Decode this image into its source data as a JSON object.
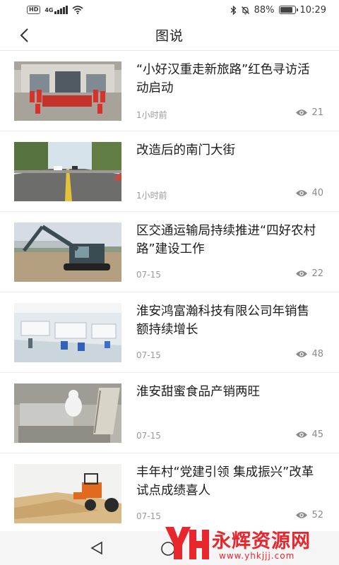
{
  "status_bar": {
    "hd_label": "HD",
    "network_label": "4G",
    "battery_percent": "88%",
    "battery_level": 0.88,
    "time": "10:29"
  },
  "header": {
    "title": "图说",
    "back_icon": "chevron-left-icon"
  },
  "articles": [
    {
      "title": "“小好汉重走新旅路”红色寻访活动启动",
      "time": "1小时前",
      "views": "21"
    },
    {
      "title": "改造后的南门大街",
      "time": "1小时前",
      "views": "40"
    },
    {
      "title": "区交通运输局持续推进“四好农村路”建设工作",
      "time": "07-15",
      "views": "22"
    },
    {
      "title": "淮安鸿富瀚科技有限公司年销售额持续增长",
      "time": "07-15",
      "views": "48"
    },
    {
      "title": "淮安甜蜜食品产销两旺",
      "time": "07-15",
      "views": "45"
    },
    {
      "title": "丰年村“党建引领 集成振兴”改革试点成绩喜人",
      "time": "07-15",
      "views": "52"
    }
  ],
  "nav_bar": {
    "back_icon": "triangle-back-icon",
    "home_icon": "circle-home-icon"
  },
  "watermark": {
    "name": "永辉资源网",
    "url": "www.yhkjjj.com",
    "accent": "#e8262e"
  }
}
